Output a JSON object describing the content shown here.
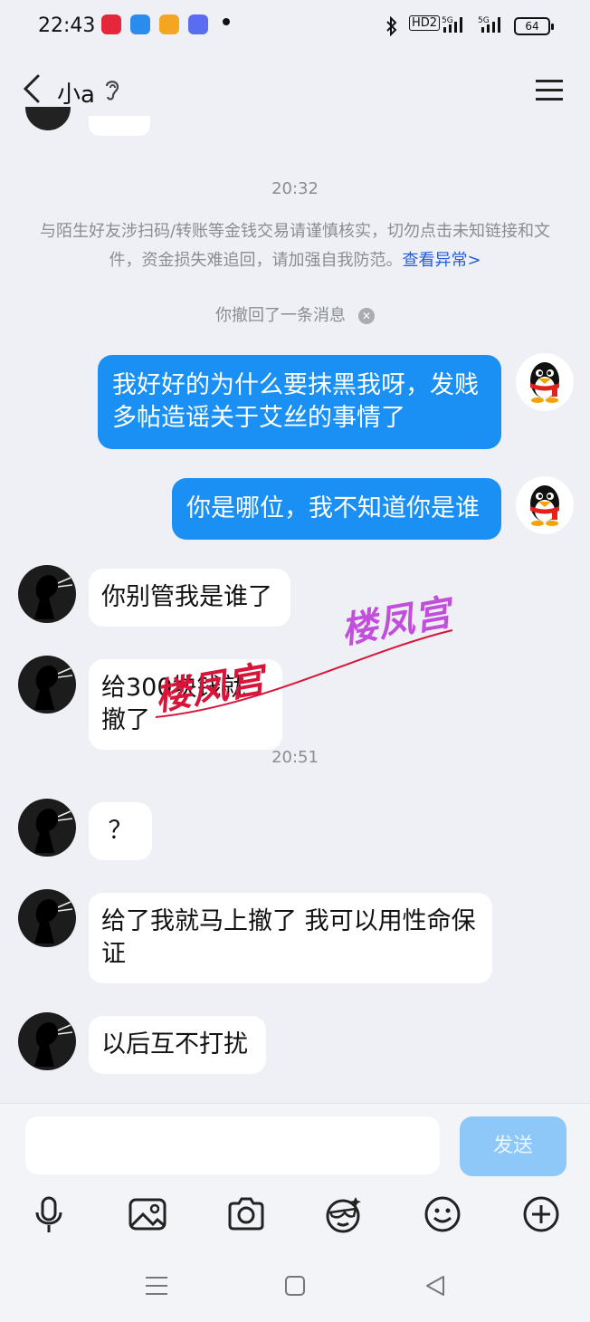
{
  "status_bar": {
    "time": "22:43",
    "network1": "HD2",
    "network2": "5G",
    "network3": "5G",
    "battery": "64"
  },
  "header": {
    "title": "小a"
  },
  "chat": {
    "time_1": "20:32",
    "notice_text": "与陌生好友涉扫码/转账等金钱交易请谨慎核实，切勿点击未知链接和文件，资金损失难追回，请加强自我防范。",
    "notice_link": "查看异常>",
    "recall_text": "你撤回了一条消息",
    "msg_me_1": "我好好的为什么要抹黑我呀，发贱多帖造谣关于艾丝的事情了",
    "msg_me_2": "你是哪位，我不知道你是谁",
    "msg_them_1": "你别管我是谁了",
    "msg_them_2": "给300块钱就撤了",
    "time_2": "20:51",
    "msg_them_3": "？",
    "msg_them_4": "给了我就马上撤了 我可以用性命保证",
    "msg_them_5": "以后互不打扰"
  },
  "watermark": {
    "text_1": "楼凤宫",
    "text_2": "楼凤宫"
  },
  "input": {
    "placeholder": "",
    "send_label": "发送"
  },
  "colors": {
    "my_bubble": "#1a90f5",
    "send_button": "#8ec8f8",
    "link": "#1e5fe0"
  },
  "toolbar_icons": [
    "microphone-icon",
    "image-icon",
    "camera-icon",
    "sticker-icon",
    "emoji-icon",
    "plus-icon"
  ],
  "nav_icons": [
    "menu-icon",
    "home-icon",
    "back-icon"
  ]
}
